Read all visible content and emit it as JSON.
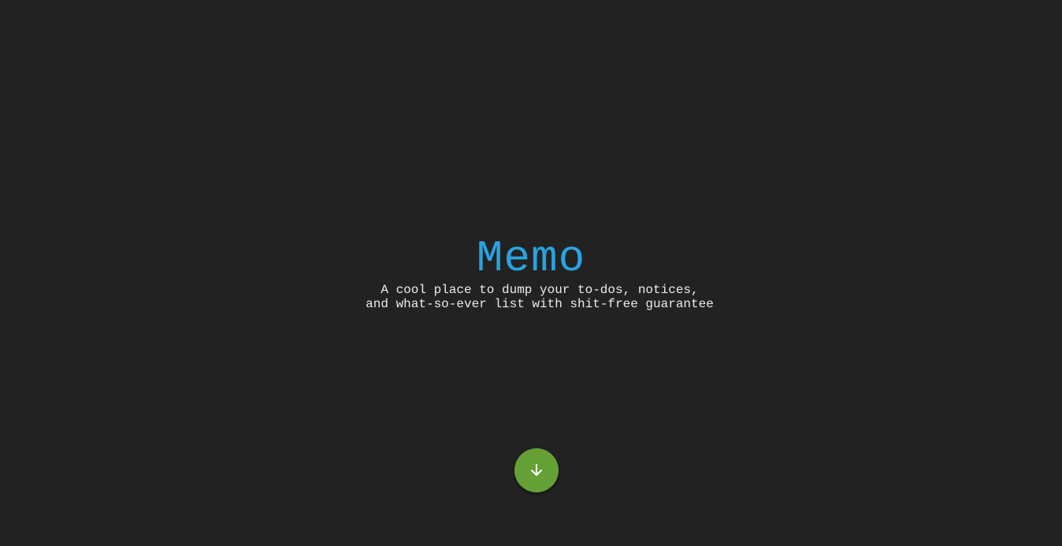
{
  "colors": {
    "background": "#222222",
    "title": "#29a3e2",
    "text": "#ececec",
    "button": "#65a037",
    "icon": "#ffffff"
  },
  "hero": {
    "title": "Memo",
    "tagline_line1": "A cool place to dump your to-dos, notices,",
    "tagline_line2": "and what-so-ever list with shit-free guarantee"
  },
  "scroll_button": {
    "icon": "arrow-down-icon"
  }
}
